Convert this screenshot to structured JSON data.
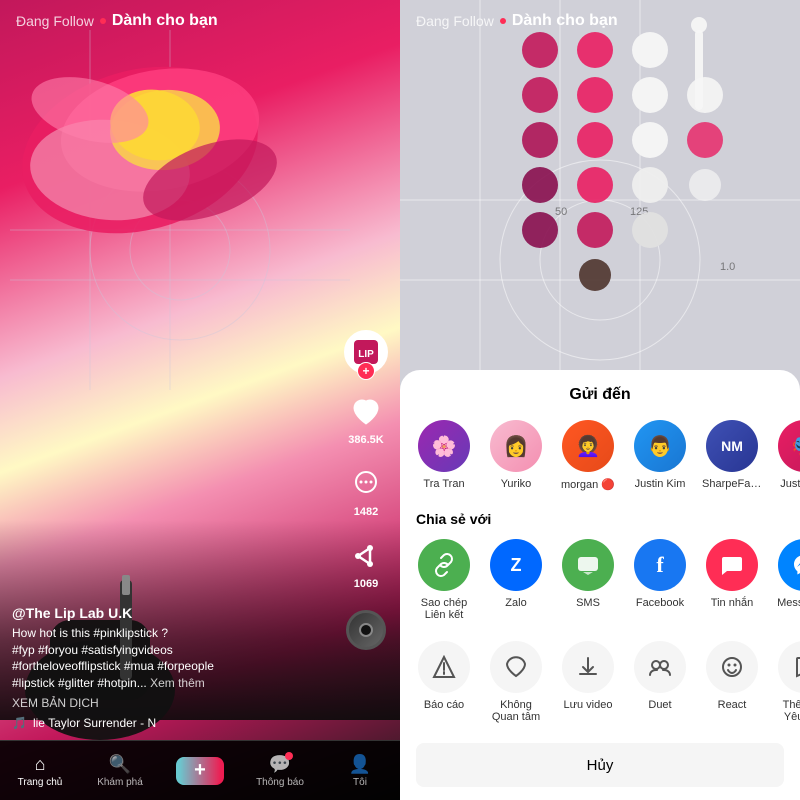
{
  "left_panel": {
    "top_nav": {
      "following_label": "Đang Follow",
      "for_you_label": "Dành cho bạn"
    },
    "username": "@The Lip Lab U.K",
    "caption": "How hot is this #pinklipstick ?\n#fyp #foryou #satisfyingvideos\n#fortheloveofflipstick #mua #forpeople\n#lipstick #glitter #hotpin...",
    "see_more": "Xem thêm",
    "translate": "XEM BẢN DỊCH",
    "music": "🎵 lie Taylor  Surrender - N",
    "likes": "386.5K",
    "comments": "1482",
    "shares": "1069",
    "bottom_nav": [
      {
        "id": "home",
        "icon": "⌂",
        "label": "Trang chủ",
        "active": true
      },
      {
        "id": "search",
        "icon": "🔍",
        "label": "Khám phá",
        "active": false
      },
      {
        "id": "add",
        "icon": "+",
        "label": "",
        "active": false
      },
      {
        "id": "inbox",
        "icon": "💬",
        "label": "Thông báo",
        "active": false
      },
      {
        "id": "profile",
        "icon": "👤",
        "label": "Tôi",
        "active": false
      }
    ]
  },
  "right_panel": {
    "top_nav": {
      "following_label": "Đang Follow",
      "for_you_label": "Dành cho bạn"
    },
    "share_panel": {
      "title": "Gửi đến",
      "friends": [
        {
          "name": "Tra Tran",
          "color": "#9c27b0",
          "emoji": "🌸"
        },
        {
          "name": "Yuriko",
          "color": "#f8bbd0",
          "emoji": "👩"
        },
        {
          "name": "morgan 🔴",
          "color": "#ff5722",
          "emoji": "👩‍🦱"
        },
        {
          "name": "Justin Kim",
          "color": "#2196f3",
          "emoji": "👨"
        },
        {
          "name": "SharpeFamilySingers",
          "color": "#3f51b5",
          "emoji": "🎵"
        },
        {
          "name": "Justin Vib",
          "color": "#e91e63",
          "emoji": "🎭"
        }
      ],
      "share_with_label": "Chia sẻ với",
      "share_options": [
        {
          "id": "copy",
          "icon": "🔗",
          "label": "Sao chép\nLiên kết",
          "color": "#4caf50"
        },
        {
          "id": "zalo",
          "icon": "Z",
          "label": "Zalo",
          "color": "#0068ff"
        },
        {
          "id": "sms",
          "icon": "💬",
          "label": "SMS",
          "color": "#4caf50"
        },
        {
          "id": "facebook",
          "icon": "f",
          "label": "Facebook",
          "color": "#1877f2"
        },
        {
          "id": "message",
          "icon": "✉",
          "label": "Tin nhắn",
          "color": "#ff2d55"
        },
        {
          "id": "messenger",
          "icon": "m",
          "label": "Messeng...",
          "color": "#0084ff"
        }
      ],
      "actions": [
        {
          "id": "report",
          "icon": "⚠",
          "label": "Báo cáo"
        },
        {
          "id": "not-interested",
          "icon": "🤍",
          "label": "Không\nQuan tâm"
        },
        {
          "id": "save",
          "icon": "⬇",
          "label": "Lưu video"
        },
        {
          "id": "duet",
          "icon": "👥",
          "label": "Duet"
        },
        {
          "id": "react",
          "icon": "☺",
          "label": "React"
        },
        {
          "id": "add-fav",
          "icon": "🔖",
          "label": "Thêm và\nYêu thíc"
        }
      ],
      "cancel_label": "Hủy"
    }
  }
}
